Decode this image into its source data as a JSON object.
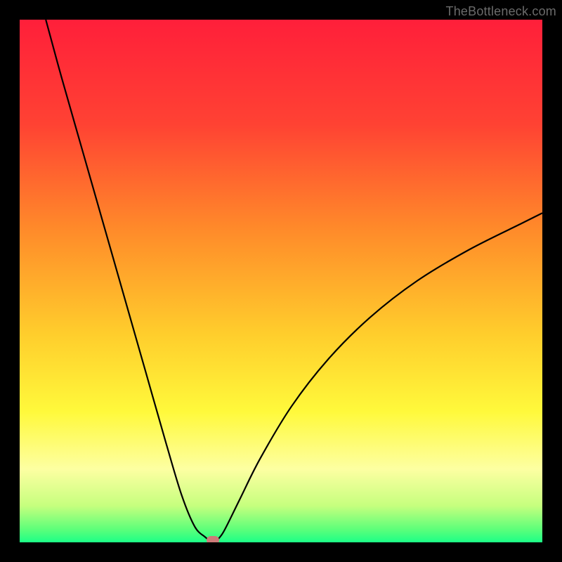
{
  "watermark": "TheBottleneck.com",
  "chart_data": {
    "type": "line",
    "title": "",
    "xlabel": "",
    "ylabel": "",
    "xlim": [
      0,
      100
    ],
    "ylim": [
      0,
      100
    ],
    "grid": false,
    "background_gradient": {
      "stops": [
        {
          "offset": 0.0,
          "color": "#ff1f3a"
        },
        {
          "offset": 0.2,
          "color": "#ff4233"
        },
        {
          "offset": 0.4,
          "color": "#ff8a2a"
        },
        {
          "offset": 0.6,
          "color": "#ffcd2c"
        },
        {
          "offset": 0.75,
          "color": "#fff93b"
        },
        {
          "offset": 0.86,
          "color": "#fdffa2"
        },
        {
          "offset": 0.93,
          "color": "#c6ff7e"
        },
        {
          "offset": 0.975,
          "color": "#5dff7a"
        },
        {
          "offset": 1.0,
          "color": "#1cff87"
        }
      ]
    },
    "series": [
      {
        "name": "bottleneck-curve",
        "color": "#000000",
        "x": [
          5,
          8,
          12,
          16,
          20,
          24,
          28,
          31,
          33.5,
          35.5,
          36.5,
          37,
          37.5,
          39,
          42,
          46,
          52,
          59,
          67,
          76,
          86,
          96,
          100
        ],
        "y": [
          100,
          89,
          75,
          61,
          47,
          33,
          19,
          9,
          3,
          1,
          0.2,
          0,
          0.2,
          2,
          8,
          16,
          26,
          35,
          43,
          50,
          56,
          61,
          63
        ]
      }
    ],
    "marker": {
      "name": "optimal-point",
      "x": 37,
      "y": 0,
      "color": "#cd7a78"
    },
    "annotations": []
  }
}
